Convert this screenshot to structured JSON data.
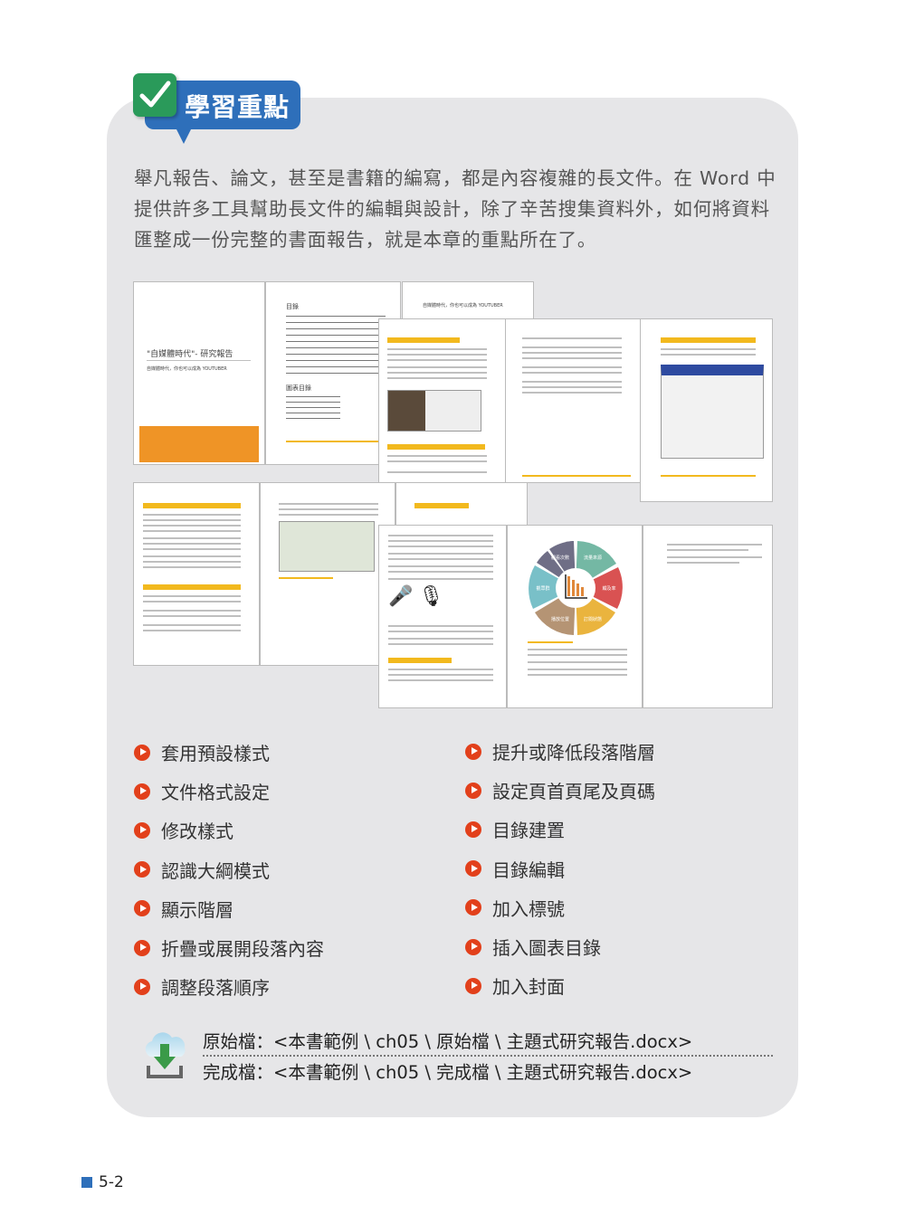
{
  "header": {
    "title": "學習重點",
    "icon": "checkmark-icon",
    "accent": "#2e6fba",
    "check_color": "#2a9a5a"
  },
  "intro": "舉凡報告、論文，甚至是書籍的編寫，都是內容複雜的長文件。在 Word 中提供許多工具幫助長文件的編輯與設計，除了辛苦搜集資料外，如何將資料匯整成一份完整的書面報告，就是本章的重點所在了。",
  "thumbnails": {
    "cover_title": "\"自媒體時代\"- 研究報告",
    "cover_subtitle": "自媒體時代，你也可以成為 YOUTUBER",
    "toc_title": "目錄",
    "figure_toc_title": "圖表目錄",
    "page3_title": "自媒體時代，你也可以成為 YOUTUBER",
    "diagram_labels": [
      "觀看次數",
      "流量來源",
      "觸及率",
      "訂閱狀態",
      "播放位置",
      "觀眾群"
    ]
  },
  "topics_left": [
    "套用預設樣式",
    "文件格式設定",
    "修改樣式",
    "認識大綱模式",
    "顯示階層",
    "折疊或展開段落內容",
    "調整段落順序"
  ],
  "topics_right": [
    "提升或降低段落階層",
    "設定頁首頁尾及頁碼",
    "目錄建置",
    "目錄編輯",
    "加入標號",
    "插入圖表目錄",
    "加入封面"
  ],
  "bullet_color": "#e2401b",
  "files": {
    "icon": "cloud-download-icon",
    "original": "原始檔：<本書範例 \\ ch05 \\ 原始檔 \\ 主題式研究報告.docx>",
    "finished": "完成檔：<本書範例 \\ ch05 \\ 完成檔 \\ 主題式研究報告.docx>"
  },
  "page_number": "5-2"
}
